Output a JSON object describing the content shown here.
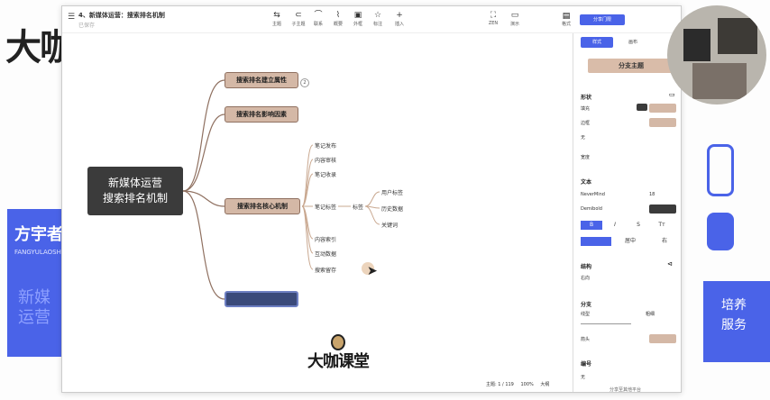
{
  "background": {
    "logo": "大咖",
    "card_title": "方宇者",
    "card_sub": "FANGYULAOSHI",
    "card_faded": "新媒运营",
    "right_card_lines": [
      "培养",
      "服务"
    ]
  },
  "header": {
    "title": "4、新媒体运营：搜索排名机制",
    "subtitle": "已保存",
    "toolbar": [
      {
        "icon": "⇆",
        "label": "主题",
        "name": "theme"
      },
      {
        "icon": "⊂",
        "label": "子主题",
        "name": "subtopic"
      },
      {
        "icon": "⌒",
        "label": "联系",
        "name": "relation"
      },
      {
        "icon": "⌇",
        "label": "概要",
        "name": "summary"
      },
      {
        "icon": "▣",
        "label": "外框",
        "name": "boundary"
      },
      {
        "icon": "☆",
        "label": "标注",
        "name": "marker"
      },
      {
        "icon": "+",
        "label": "插入",
        "name": "insert"
      }
    ],
    "right_tools": [
      {
        "icon": "⛶",
        "label": "ZEN",
        "name": "zen"
      },
      {
        "icon": "▭",
        "label": "演示",
        "name": "present"
      }
    ],
    "style_label": "格式",
    "share_label": "分享门限"
  },
  "mindmap": {
    "root": [
      "新媒体运营",
      "搜索排名机制"
    ],
    "branches": [
      "搜索排名建立属性",
      "搜索排名影响因素",
      "搜索排名核心机制",
      ""
    ],
    "badge": "2",
    "leaves_top": [
      "笔记发布",
      "内容审核",
      "笔记收录"
    ],
    "leaf_note_tag": "笔记标签",
    "leaf_tag": "标签",
    "leaves_tag": [
      "用户标签",
      "历史数据",
      "关键词"
    ],
    "leaves_bottom": [
      "内容索引",
      "互动数据",
      "搜索留存"
    ]
  },
  "watermark": "大咖课堂",
  "status": {
    "topic": "主题: 1 / 119",
    "zoom": "100%",
    "size": "大纲"
  },
  "panel": {
    "tabs": [
      "样式",
      "画布"
    ],
    "style_button": "分支主题",
    "shape_section": "形状",
    "fill_label": "填充",
    "border_label": "边框",
    "none_label": "无",
    "width_label": "宽度",
    "text_section": "文本",
    "font": "NeverMind",
    "font_size": "18",
    "weight": "Demibold",
    "format_buttons": [
      "B",
      "I",
      "S",
      "Tт"
    ],
    "align_buttons": [
      "",
      "居中",
      "右"
    ],
    "structure_section": "结构",
    "structure_value": "右向",
    "branch_section": "分支",
    "branch_line_label": "线型",
    "branch_style_label": "粗细",
    "arrow_label": "箭头",
    "number_section": "编号",
    "number_value": "无",
    "footer": "分享至其他平台"
  },
  "colors": {
    "accent": "#4a63e8",
    "node_fill": "#d4b8a6",
    "node_border": "#8f7060",
    "root_fill": "#3b3b3b",
    "selected_fill": "#3a4a7a"
  }
}
